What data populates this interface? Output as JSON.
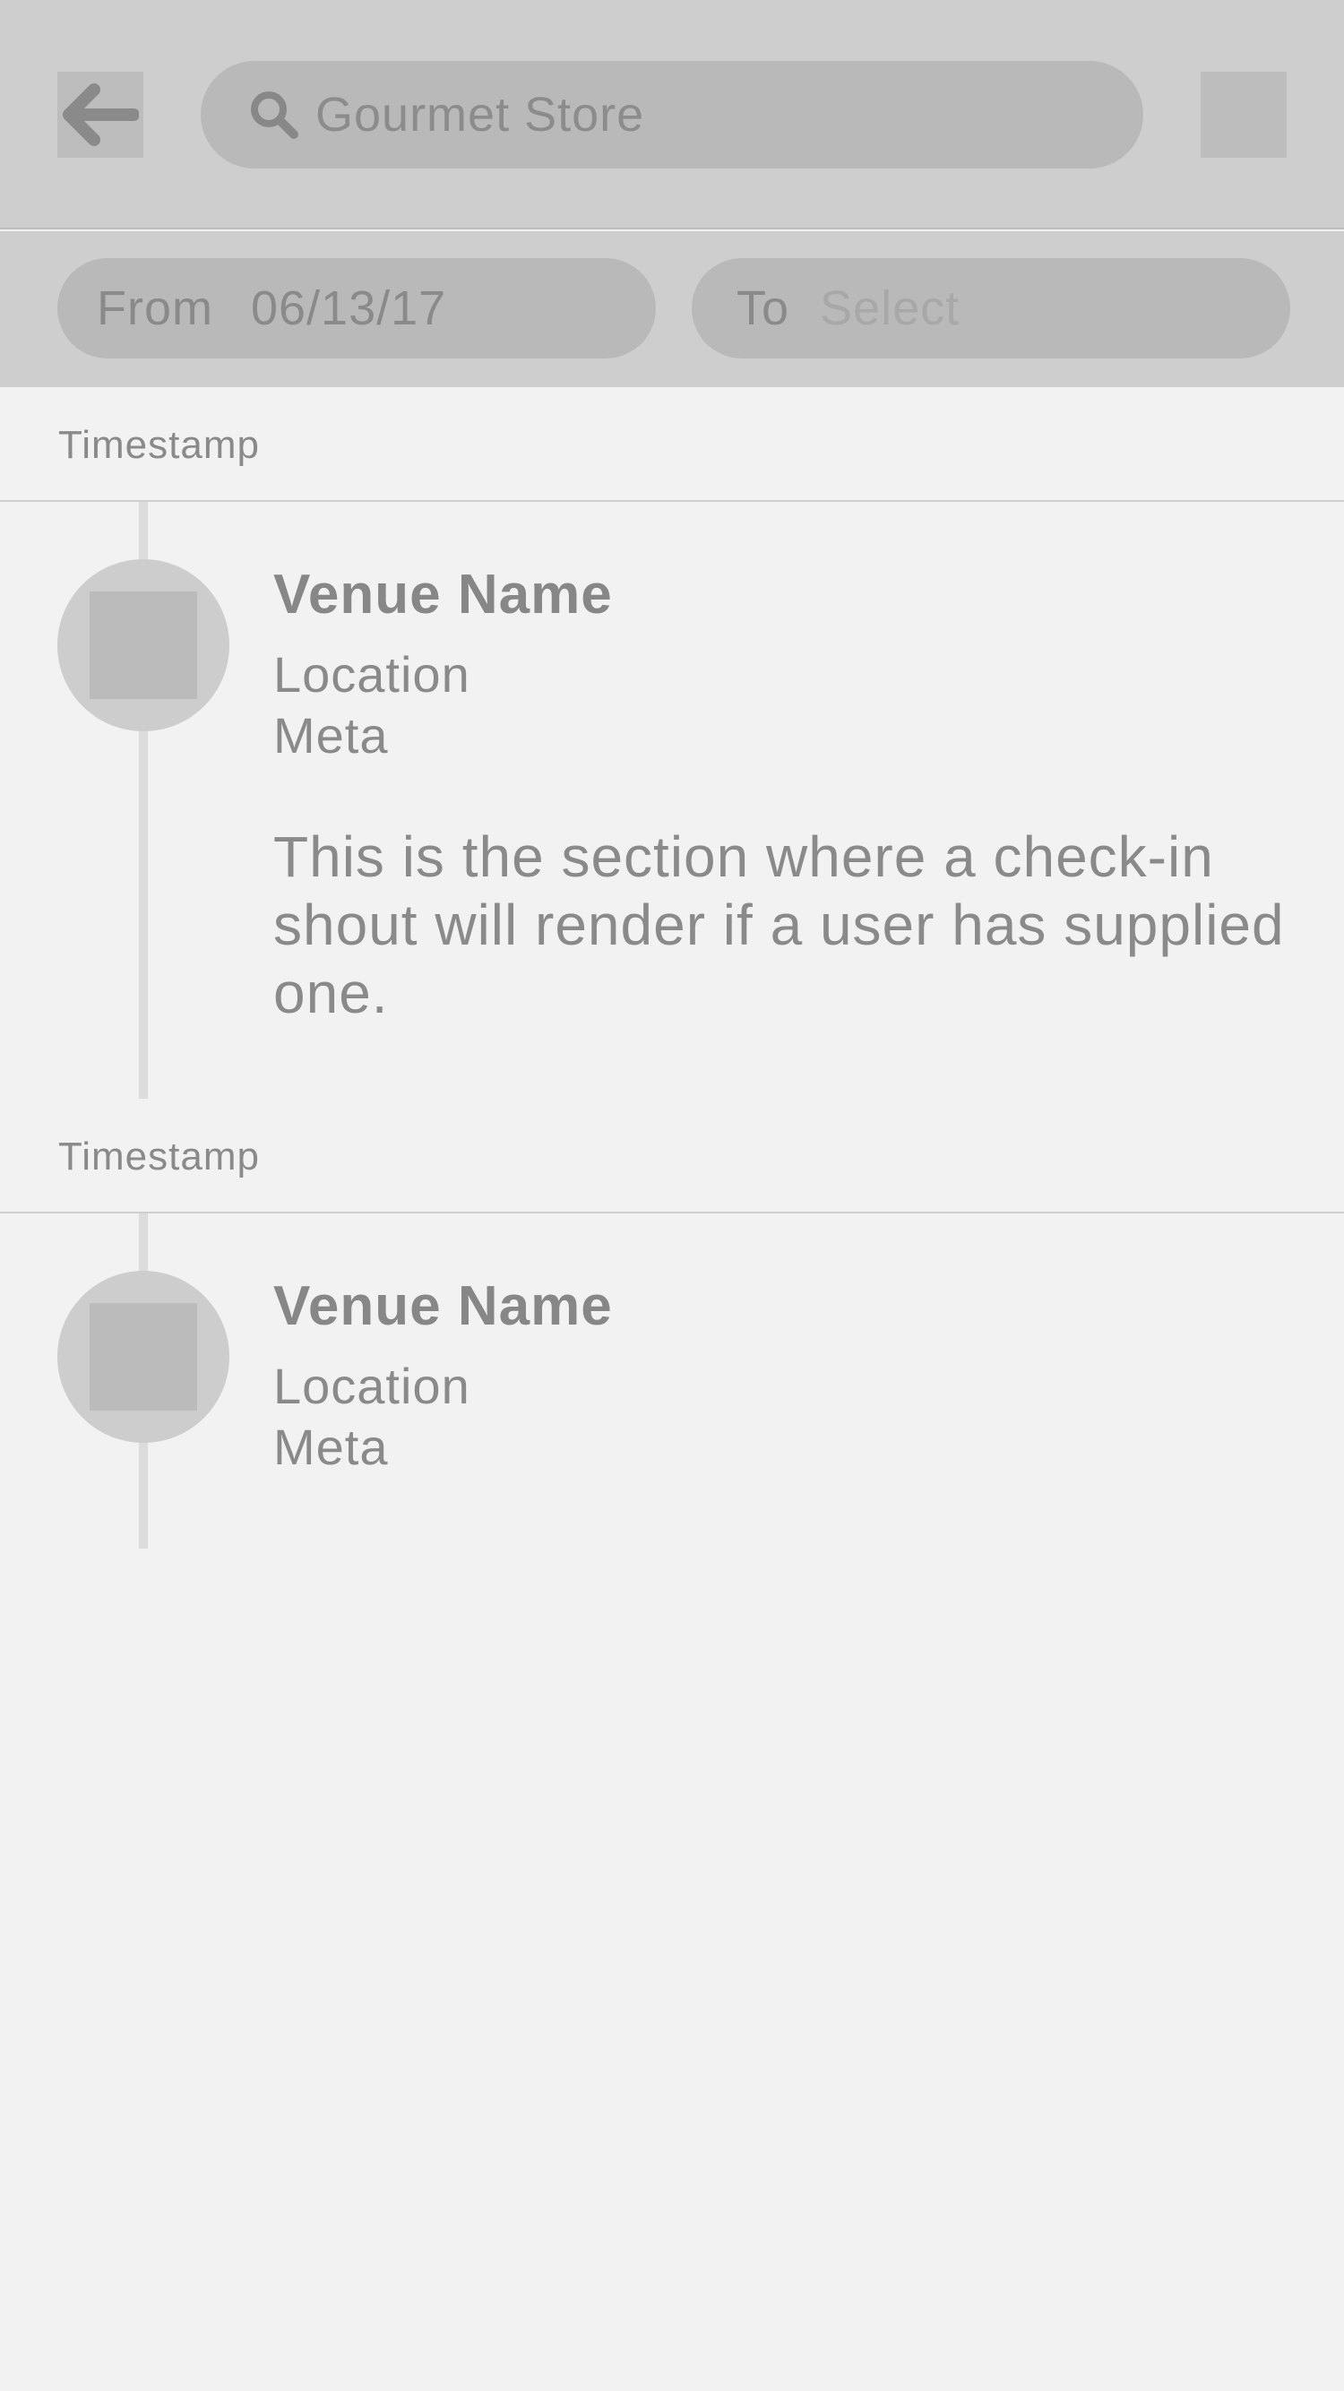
{
  "header": {
    "search": {
      "value": "Gourmet Store"
    }
  },
  "filters": {
    "from": {
      "label": "From",
      "value": "06/13/17"
    },
    "to": {
      "label": "To",
      "placeholder": "Select"
    }
  },
  "checkins": [
    {
      "timestamp": "Timestamp",
      "venue_name": "Venue Name",
      "location": "Location",
      "meta": "Meta",
      "shout": "This is the section where a check-in shout will render if a user has supplied one."
    },
    {
      "timestamp": "Timestamp",
      "venue_name": "Venue Name",
      "location": "Location",
      "meta": "Meta"
    }
  ],
  "icons": {
    "back": "arrow-left-icon",
    "search": "magnifier-icon",
    "menu": "placeholder-square-icon"
  }
}
